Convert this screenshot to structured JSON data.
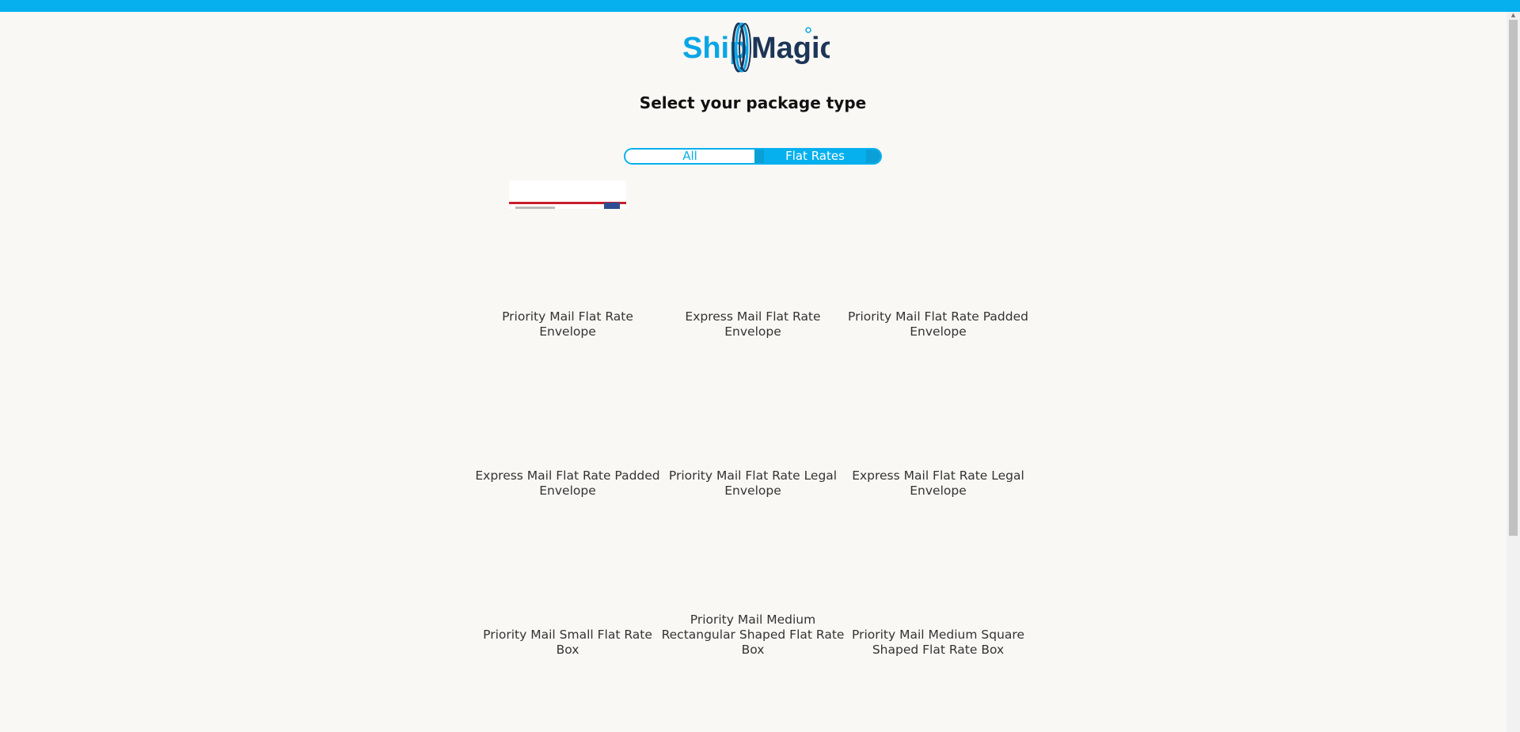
{
  "header": {
    "logo_alt": "ShipMagic"
  },
  "page": {
    "title": "Select your package type"
  },
  "toggle": {
    "options": [
      {
        "label": "All",
        "selected": false
      },
      {
        "label": "Flat Rates",
        "selected": true
      }
    ]
  },
  "packages": [
    {
      "label": "Priority Mail Flat Rate Envelope",
      "icon": "envelope-thumbnail"
    },
    {
      "label": "Express Mail Flat Rate Envelope"
    },
    {
      "label": "Priority Mail Flat Rate Padded Envelope"
    },
    {
      "label": "Express Mail Flat Rate Padded Envelope"
    },
    {
      "label": "Priority Mail Flat Rate Legal Envelope"
    },
    {
      "label": "Express Mail Flat Rate Legal Envelope"
    },
    {
      "label": "Priority Mail Small Flat Rate Box"
    },
    {
      "label": "Priority Mail Medium Rectangular Shaped Flat Rate Box"
    },
    {
      "label": "Priority Mail Medium Square Shaped Flat Rate Box"
    }
  ],
  "colors": {
    "accent": "#06b0ee",
    "logo_dark": "#1d3557",
    "background": "#f9f8f5"
  }
}
